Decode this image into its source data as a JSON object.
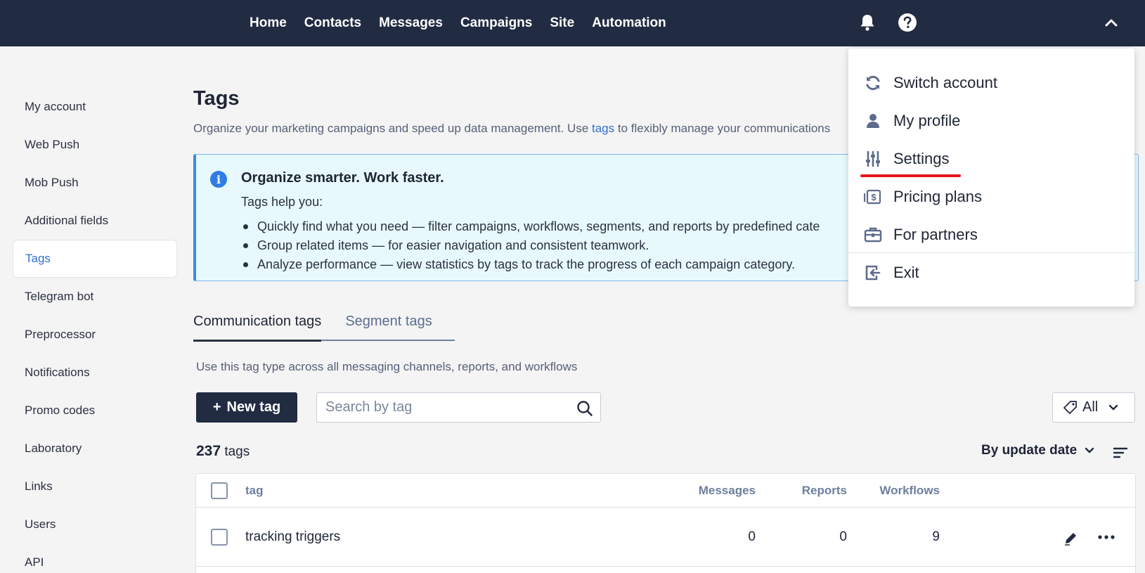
{
  "nav": {
    "items": [
      "Home",
      "Contacts",
      "Messages",
      "Campaigns",
      "Site",
      "Automation"
    ]
  },
  "icons": {
    "bell": "bell-icon",
    "help": "question-icon",
    "collapse": "chevron-up-icon"
  },
  "sidebar": {
    "items": [
      {
        "label": "My account"
      },
      {
        "label": "Web Push"
      },
      {
        "label": "Mob Push"
      },
      {
        "label": "Additional fields"
      },
      {
        "label": "Tags",
        "active": true
      },
      {
        "label": "Telegram bot"
      },
      {
        "label": "Preprocessor"
      },
      {
        "label": "Notifications"
      },
      {
        "label": "Promo codes"
      },
      {
        "label": "Laboratory"
      },
      {
        "label": "Links"
      },
      {
        "label": "Users"
      },
      {
        "label": "API"
      }
    ]
  },
  "page": {
    "title": "Tags",
    "desc_before": "Organize your marketing campaigns and speed up data management. Use ",
    "desc_link": "tags",
    "desc_after": " to flexibly manage your communications"
  },
  "info": {
    "title": "Organize smarter. Work faster.",
    "subtitle": "Tags help you:",
    "bullets": [
      "Quickly find what you need — filter campaigns, workflows, segments, and reports by predefined cate",
      "Group related items — for easier navigation and consistent teamwork.",
      "Analyze performance — view statistics by tags to track the progress of each campaign category."
    ]
  },
  "tabs": {
    "communication": "Communication tags",
    "segment": "Segment tags"
  },
  "tab_desc": "Use this tag type across all messaging channels, reports, and workflows",
  "toolbar": {
    "new_tag": "New tag",
    "search_placeholder": "Search by tag",
    "filter_value": "All"
  },
  "list": {
    "count": "237",
    "count_unit": "tags",
    "sort_label": "By update date"
  },
  "table": {
    "headers": {
      "tag": "tag",
      "messages": "Messages",
      "reports": "Reports",
      "workflows": "Workflows"
    },
    "rows": [
      {
        "tag": "tracking triggers",
        "messages": "0",
        "reports": "0",
        "workflows": "9"
      }
    ]
  },
  "dropdown": {
    "items": [
      {
        "label": "Switch account",
        "icon": "refresh-icon"
      },
      {
        "label": "My profile",
        "icon": "user-icon"
      },
      {
        "label": "Settings",
        "icon": "sliders-icon"
      },
      {
        "label": "Pricing plans",
        "icon": "banknote-icon"
      },
      {
        "label": "For partners",
        "icon": "briefcase-icon"
      },
      {
        "label": "Exit",
        "icon": "exit-icon"
      }
    ],
    "highlight_color": "#e8141c"
  },
  "colors": {
    "navbar": "#212b42",
    "accent": "#2f6fd6",
    "info_bg": "#e8f9fd"
  }
}
